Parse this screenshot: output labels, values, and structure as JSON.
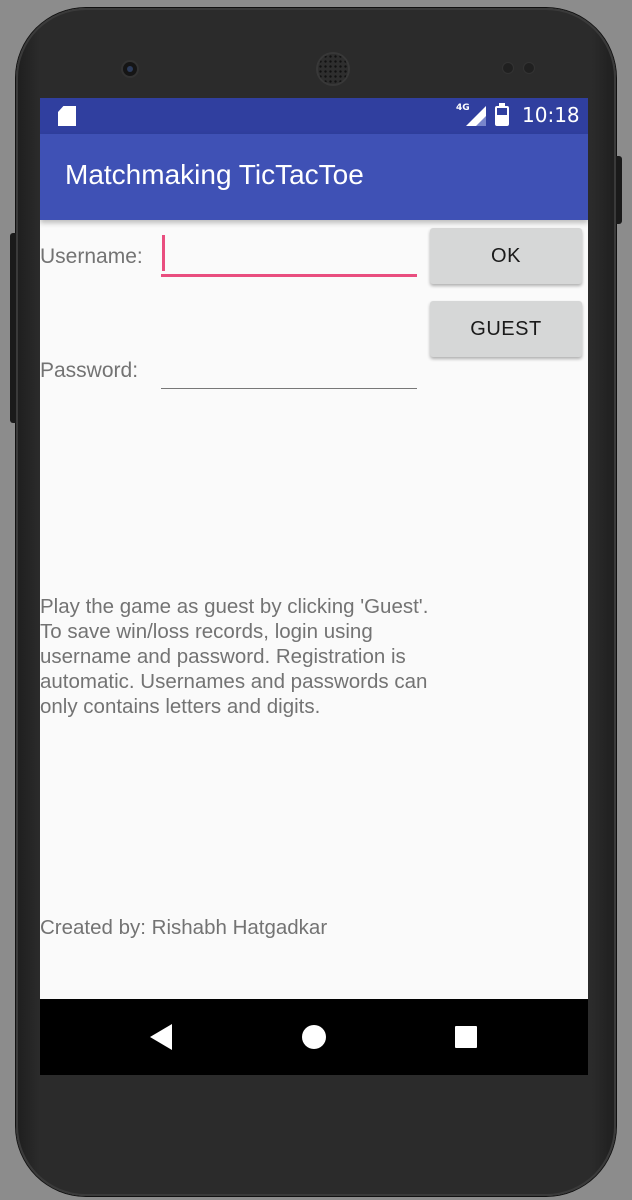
{
  "status_bar": {
    "network_type": "4G",
    "time": "10:18",
    "icons": [
      "sd-card-icon",
      "signal-icon",
      "battery-icon"
    ]
  },
  "app_bar": {
    "title": "Matchmaking TicTacToe"
  },
  "login_form": {
    "username_label": "Username:",
    "username_value": "",
    "password_label": "Password:",
    "password_value": "",
    "ok_button": "OK",
    "guest_button": "GUEST"
  },
  "info_text": "Play the game as guest by clicking 'Guest'.  To save win/loss records, login using username and password. Registration is automatic.  Usernames and passwords can only contains letters and digits.",
  "footer_text": "Created by: Rishabh Hatgadkar",
  "nav_bar": {
    "icons": [
      "back-icon",
      "home-icon",
      "recents-icon"
    ]
  },
  "colors": {
    "status_bar": "#303f9f",
    "app_bar": "#3f51b5",
    "accent": "#e94e7f",
    "button": "#d6d7d7"
  }
}
